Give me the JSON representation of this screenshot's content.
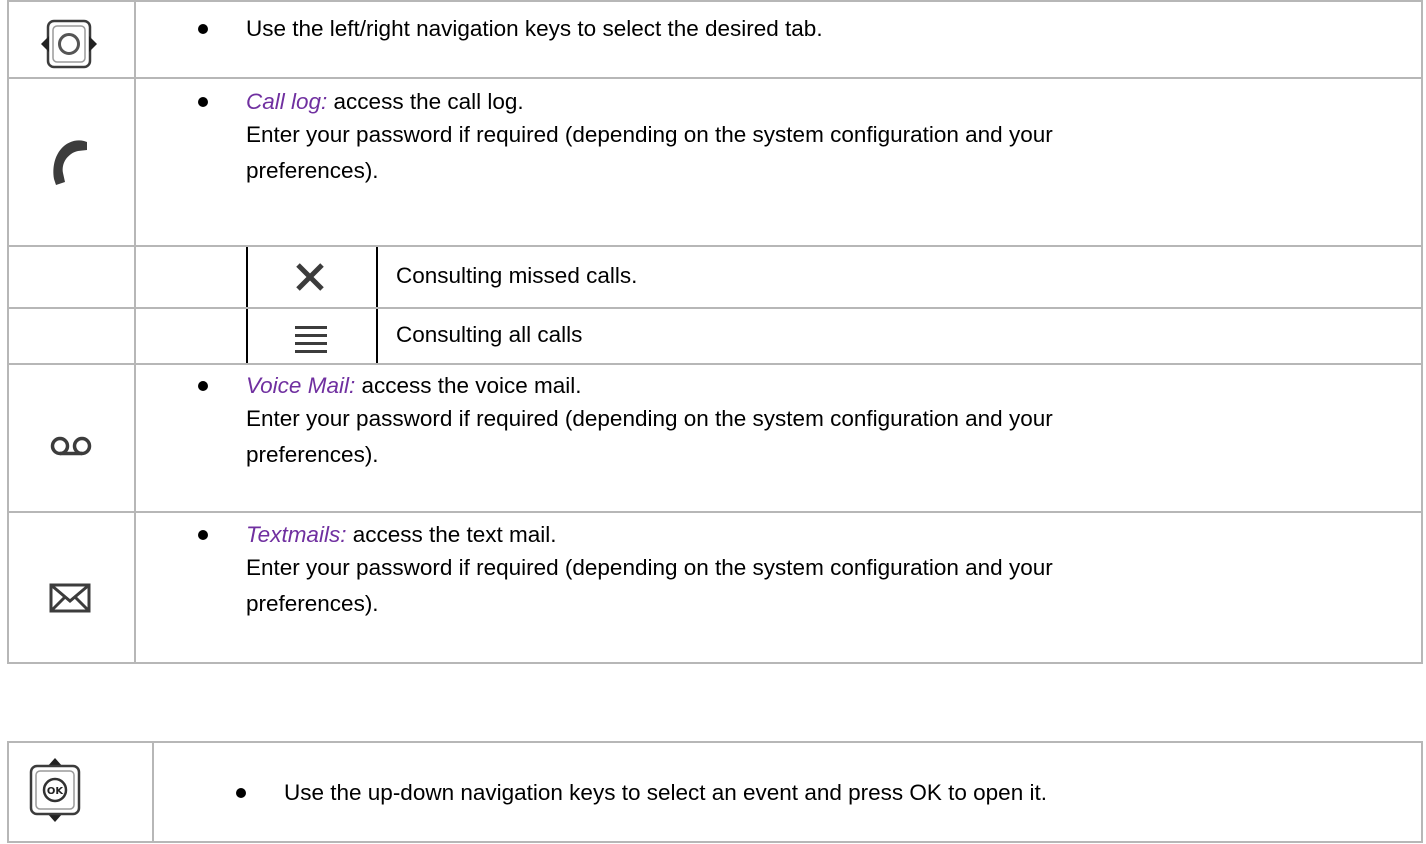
{
  "navigation": {
    "text": "Use the left/right navigation keys to select the desired tab.",
    "icon": "left-right-navigation-key-icon"
  },
  "call_log": {
    "term": "Call log:",
    "text": " access the call log.",
    "line2": "Enter your password if required (depending on the system configuration and your",
    "line3": "preferences).",
    "icon": "phone-handset-icon"
  },
  "missed_calls": {
    "text": "Consulting missed calls.",
    "icon": "cross-icon"
  },
  "all_calls": {
    "text": "Consulting all calls",
    "icon": "list-lines-icon"
  },
  "voice_mail": {
    "term": "Voice Mail:",
    "text": " access the voice mail.",
    "line2": "Enter your password if required (depending on the system configuration and your",
    "line3": "preferences).",
    "icon": "voicemail-icon"
  },
  "textmails": {
    "term": "Textmails:",
    "text": " access the text mail.",
    "line2": "Enter your password if required (depending on the system configuration and your",
    "line3": "preferences).",
    "icon": "envelope-icon"
  },
  "up_down": {
    "text": "Use the up-down navigation keys to select an event and press OK to open it.",
    "icon": "up-down-navigation-ok-key-icon",
    "key_label": "OK"
  },
  "colors": {
    "term_color": "#7030a0",
    "border_color": "#b7b7b7",
    "icon_color": "#3c3c3c"
  }
}
